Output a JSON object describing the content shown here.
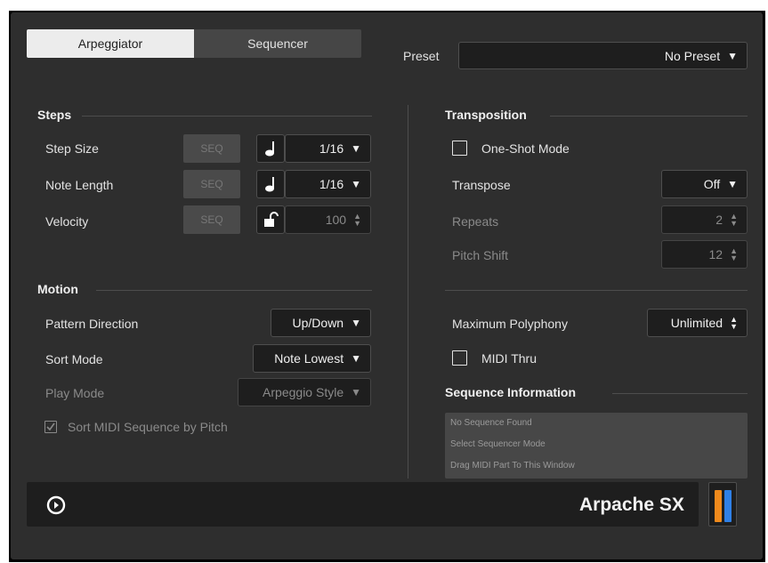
{
  "tabs": {
    "arpeggiator": "Arpeggiator",
    "sequencer": "Sequencer"
  },
  "preset": {
    "label": "Preset",
    "value": "No Preset",
    "arrow": "▼"
  },
  "steps": {
    "title": "Steps",
    "step_size": {
      "label": "Step Size",
      "seq": "SEQ",
      "icon": "quarter-note-icon",
      "value": "1/16"
    },
    "note_length": {
      "label": "Note Length",
      "seq": "SEQ",
      "icon": "quarter-note-icon",
      "value": "1/16"
    },
    "velocity": {
      "label": "Velocity",
      "seq": "SEQ",
      "icon": "unlock-icon",
      "value": "100"
    }
  },
  "motion": {
    "title": "Motion",
    "pattern_direction": {
      "label": "Pattern Direction",
      "value": "Up/Down"
    },
    "sort_mode": {
      "label": "Sort Mode",
      "value": "Note Lowest"
    },
    "play_mode": {
      "label": "Play Mode",
      "value": "Arpeggio Style"
    },
    "sort_midi": {
      "label": "Sort MIDI Sequence by Pitch",
      "checked": true
    }
  },
  "transposition": {
    "title": "Transposition",
    "one_shot": {
      "label": "One-Shot Mode",
      "checked": false
    },
    "transpose": {
      "label": "Transpose",
      "value": "Off"
    },
    "repeats": {
      "label": "Repeats",
      "value": "2"
    },
    "pitch_shift": {
      "label": "Pitch Shift",
      "value": "12"
    }
  },
  "polyphony": {
    "label": "Maximum Polyphony",
    "value": "Unlimited"
  },
  "midi_thru": {
    "label": "MIDI Thru",
    "checked": false
  },
  "sequence_info": {
    "title": "Sequence Information",
    "lines": [
      "No Sequence Found",
      "Select Sequencer Mode",
      "Drag MIDI Part To This Window"
    ]
  },
  "footer": {
    "brand": "Arpache SX",
    "play_icon": "play-circle-icon"
  },
  "colors": {
    "accent_orange": "#f08a1c",
    "accent_blue": "#2f80e6"
  }
}
